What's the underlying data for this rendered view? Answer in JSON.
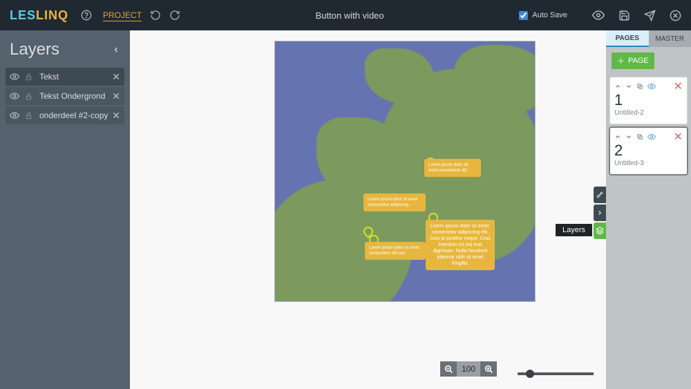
{
  "app": {
    "logo_part1": "LES",
    "logo_part2": "LINQ"
  },
  "header": {
    "project_link": "PROJECT",
    "title": "Button with video",
    "autosave_label": "Auto Save",
    "autosave_checked": true
  },
  "layers_panel": {
    "title": "Layers",
    "items": [
      {
        "name": "Tekst"
      },
      {
        "name": "Tekst Ondergrond"
      },
      {
        "name": "onderdeel #2-copy"
      }
    ]
  },
  "canvas": {
    "bubbles": {
      "small1": "Lorem ipsum dolor sit amet consectetur elit.",
      "small2": "Lorem ipsum dolor sit amet consectetur adipiscing.",
      "small3": "Lorem ipsum dolor sit amet consectetur elit sed.",
      "big": "Lorem ipsum dolor sit amet, consectetur adipiscing elit. Duis id porttitor neque. Cras interdum mi nisi erat dignissim. Nulla hendrerit placerat nibh sit amet fringilla."
    },
    "zoom": {
      "value": "100"
    }
  },
  "right_panel": {
    "tabs": {
      "pages": "PAGES",
      "master": "MASTER"
    },
    "add_page_label": "PAGE",
    "pages": [
      {
        "num": "1",
        "title": "Untitled-2"
      },
      {
        "num": "2",
        "title": "Untitled-3"
      }
    ]
  },
  "tooltip": {
    "layers": "Layers"
  }
}
